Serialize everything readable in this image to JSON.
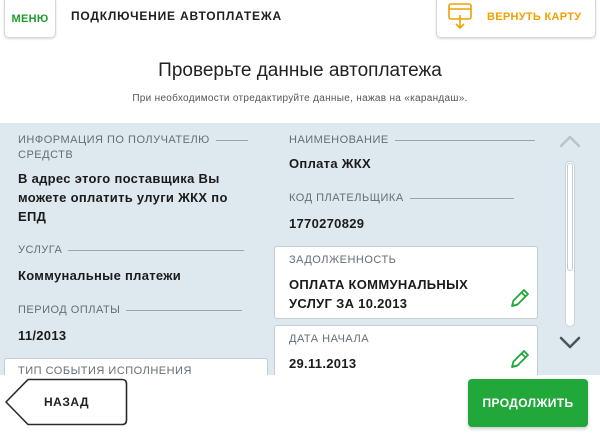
{
  "header": {
    "menu_label": "МЕНЮ",
    "title": "ПОДКЛЮЧЕНИЕ АВТОПЛАТЕЖА",
    "return_card_label": "ВЕРНУТЬ КАРТУ"
  },
  "page": {
    "title": "Проверьте данные автоплатежа",
    "subtitle": "При необходимости отредактируйте данные, нажав на «карандаш»."
  },
  "fields": {
    "recipient_info": {
      "label": "ИНФОРМАЦИЯ ПО ПОЛУЧАТЕЛЮ СРЕДСТВ",
      "label_line1": "ИНФОРМАЦИЯ ПО ПОЛУЧАТЕЛЮ",
      "label_line2": "СРЕДСТВ",
      "value": "В адрес этого поставщика Вы можете оплатить улуги ЖКХ по ЕПД",
      "value_line1": "В адрес этого поставщика Вы",
      "value_line2": "можете оплатить улуги ЖКХ по",
      "value_line3": "ЕПД"
    },
    "service": {
      "label": "УСЛУГА",
      "value": "Коммунальные платежи"
    },
    "payment_period": {
      "label": "ПЕРИОД ОПЛАТЫ",
      "value": "11/2013"
    },
    "event_type": {
      "label": "ТИП СОБЫТИЯ ИСПОЛНЕНИЯ"
    },
    "name": {
      "label": "НАИМЕНОВАНИЕ",
      "value": "Оплата ЖКХ"
    },
    "payer_code": {
      "label": "КОД ПЛАТЕЛЬЩИКА",
      "value": "1770270829"
    },
    "debt": {
      "label": "ЗАДОЛЖЕННОСТЬ",
      "value": "ОПЛАТА КОММУНАЛЬНЫХ УСЛУГ ЗА 10.2013",
      "value_line1": "ОПЛАТА КОММУНАЛЬНЫХ",
      "value_line2": "УСЛУГ ЗА 10.2013"
    },
    "start_date": {
      "label": "ДАТА НАЧАЛА",
      "value": "29.11.2013"
    }
  },
  "footer": {
    "back_label": "НАЗАД",
    "next_label": "ПРОДОЛЖИТЬ"
  },
  "colors": {
    "accent_green": "#22a83a",
    "accent_orange": "#f0a000",
    "panel_bg": "#dde8ef"
  },
  "icons": [
    "card-return-icon",
    "pencil-icon",
    "chevron-up-icon",
    "chevron-down-icon"
  ]
}
